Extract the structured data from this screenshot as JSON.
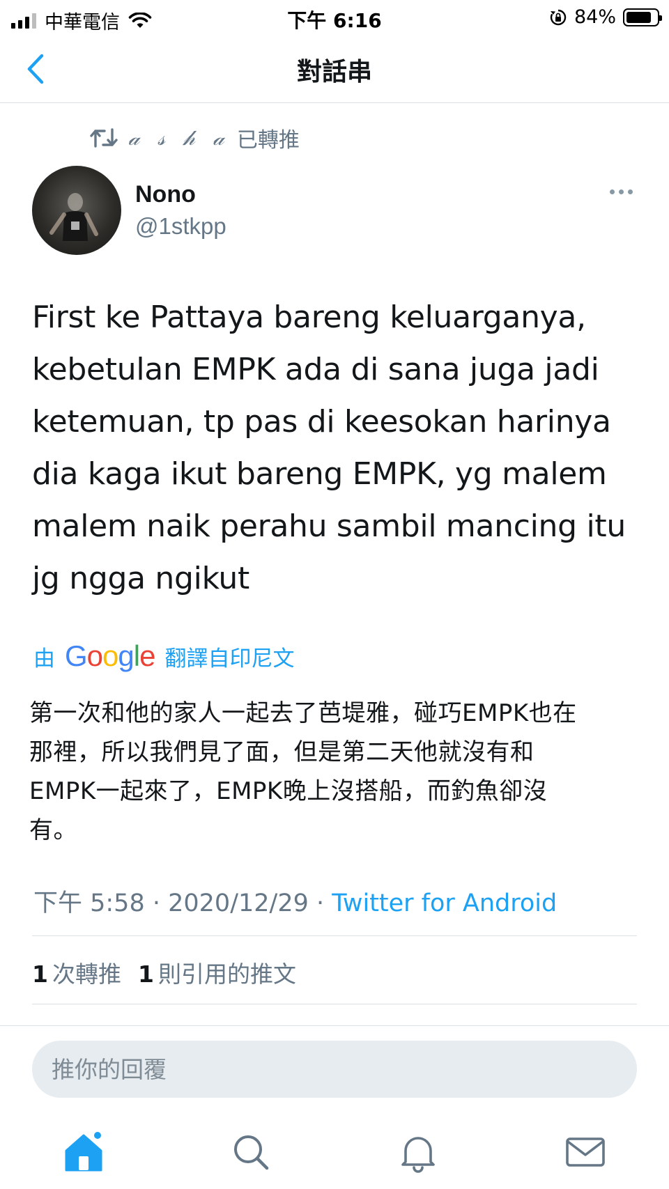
{
  "status_bar": {
    "carrier": "中華電信",
    "time": "下午 6:16",
    "battery_percent": "84%",
    "battery_level": 0.84,
    "signal_bars_active": 3,
    "signal_bars_total": 4
  },
  "nav": {
    "title": "對話串",
    "back_icon": "chevron-left-icon"
  },
  "retweet": {
    "icon": "retweet-icon",
    "name": "𝒶 𝓈 𝒽 𝒶",
    "suffix": "已轉推"
  },
  "author": {
    "name": "Nono",
    "handle": "@1stkpp"
  },
  "tweet": {
    "lines": [
      "First ke Pattaya bareng keluarganya,",
      "kebetulan EMPK ada di sana juga jadi",
      "ketemuan, tp pas di keesokan harinya",
      "dia kaga ikut bareng EMPK, yg malem",
      "malem naik perahu sambil mancing itu",
      "jg ngga ngikut"
    ]
  },
  "translation": {
    "by": "由",
    "engine": "Google",
    "label": "翻譯自印尼文",
    "lines": [
      "第一次和他的家人一起去了芭堤雅，碰巧EMPK也在",
      "那裡，所以我們見了面，但是第二天他就沒有和",
      "EMPK一起來了，EMPK晚上沒搭船，而釣魚卻沒",
      "有。"
    ]
  },
  "meta": {
    "time": "下午 5:58",
    "separator": " · ",
    "date": "2020/12/29",
    "source": "Twitter for Android"
  },
  "stats": {
    "retweets_count": "1",
    "retweets_label": "次轉推",
    "quotes_count": "1",
    "quotes_label": "則引用的推文"
  },
  "reply": {
    "placeholder": "推你的回覆"
  },
  "tabs": [
    {
      "icon": "home-icon",
      "active": true
    },
    {
      "icon": "search-icon",
      "active": false
    },
    {
      "icon": "bell-icon",
      "active": false
    },
    {
      "icon": "mail-icon",
      "active": false
    }
  ],
  "colors": {
    "accent": "#1da1f2",
    "secondary_text": "#657786",
    "primary_text": "#14171a",
    "reply_bg": "#e6ecf0"
  }
}
